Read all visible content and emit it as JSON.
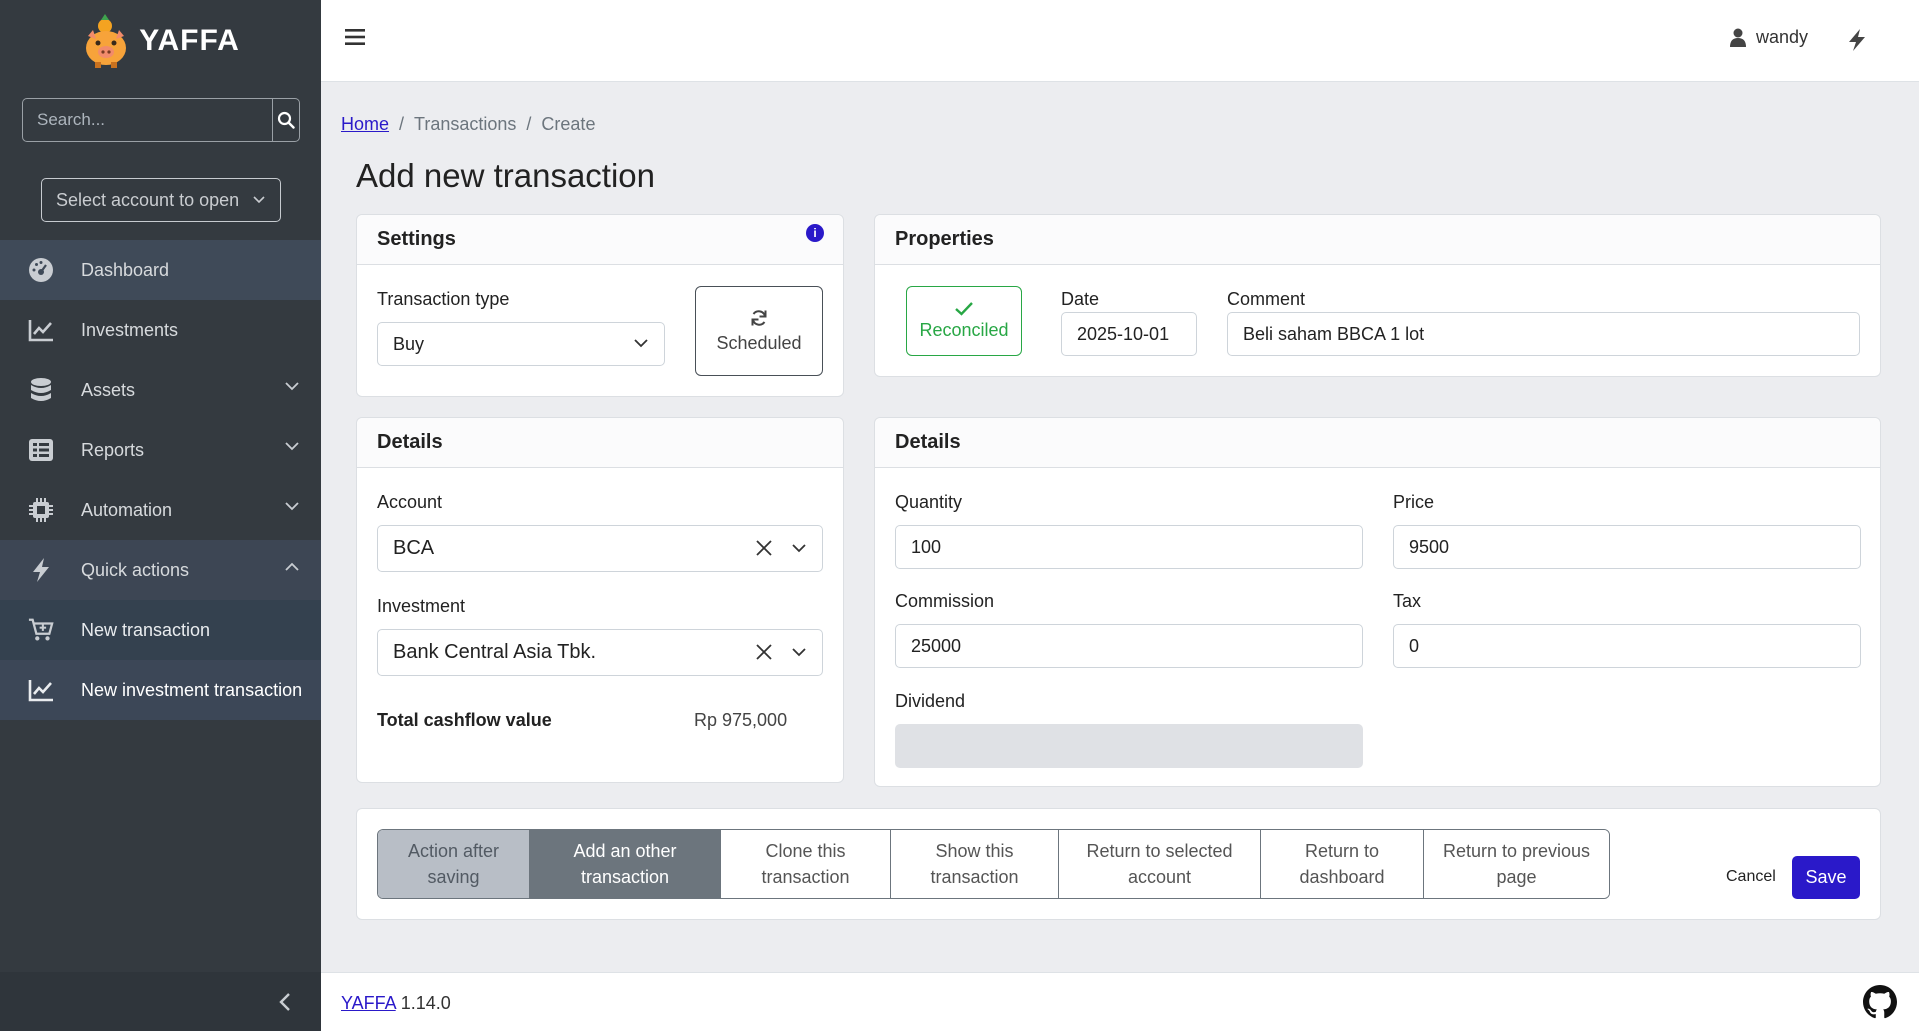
{
  "brand": {
    "name": "YAFFA"
  },
  "sidebar": {
    "search_placeholder": "Search...",
    "account_select": "Select account to open",
    "nav": [
      {
        "label": "Dashboard",
        "icon": "dashboard-icon"
      },
      {
        "label": "Investments",
        "icon": "chart-line-icon"
      },
      {
        "label": "Assets",
        "icon": "database-icon"
      },
      {
        "label": "Reports",
        "icon": "list-icon"
      },
      {
        "label": "Automation",
        "icon": "microchip-icon"
      },
      {
        "label": "Quick actions",
        "icon": "bolt-icon"
      }
    ],
    "quick_actions": [
      {
        "label": "New transaction",
        "icon": "cart-plus-icon"
      },
      {
        "label": "New investment transaction",
        "icon": "chart-line-icon"
      }
    ]
  },
  "topbar": {
    "user": "wandy"
  },
  "breadcrumb": {
    "home": "Home",
    "sep": "/",
    "transactions": "Transactions",
    "create": "Create"
  },
  "page_title": "Add new transaction",
  "settings": {
    "title": "Settings",
    "transaction_type_label": "Transaction type",
    "transaction_type_value": "Buy",
    "scheduled_label": "Scheduled"
  },
  "properties": {
    "title": "Properties",
    "reconciled_label": "Reconciled",
    "date_label": "Date",
    "date_value": "2025-10-01",
    "comment_label": "Comment",
    "comment_value": "Beli saham BBCA 1 lot"
  },
  "details_left": {
    "title": "Details",
    "account_label": "Account",
    "account_value": "BCA",
    "investment_label": "Investment",
    "investment_value": "Bank Central Asia Tbk.",
    "total_label": "Total cashflow value",
    "total_value": "Rp 975,000"
  },
  "details_right": {
    "title": "Details",
    "quantity_label": "Quantity",
    "quantity_value": "100",
    "price_label": "Price",
    "price_value": "9500",
    "commission_label": "Commission",
    "commission_value": "25000",
    "tax_label": "Tax",
    "tax_value": "0",
    "dividend_label": "Dividend"
  },
  "after_saving": {
    "label_line1": "Action after",
    "label_line2": "saving",
    "options": [
      {
        "line1": "Add an other",
        "line2": "transaction"
      },
      {
        "line1": "Clone this",
        "line2": "transaction"
      },
      {
        "line1": "Show this",
        "line2": "transaction"
      },
      {
        "line1": "Return to selected",
        "line2": "account"
      },
      {
        "line1": "Return to",
        "line2": "dashboard"
      },
      {
        "line1": "Return to previous",
        "line2": "page"
      }
    ],
    "selected_index": 0
  },
  "buttons": {
    "cancel": "Cancel",
    "save": "Save"
  },
  "footer": {
    "link": "YAFFA",
    "version": "1.14.0"
  },
  "colors": {
    "primary": "#2a19c9",
    "sidebar_bg": "#343a40",
    "success": "#28a745"
  }
}
